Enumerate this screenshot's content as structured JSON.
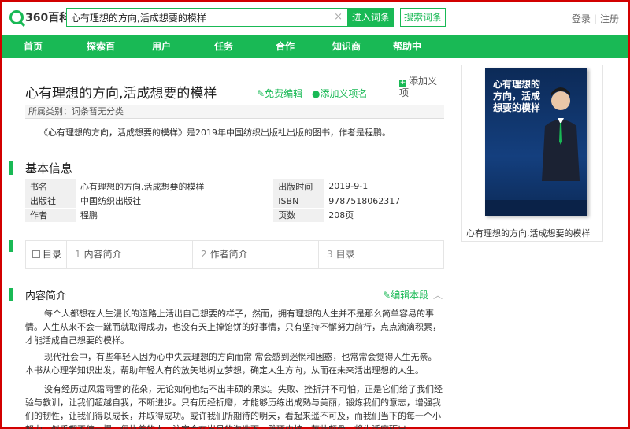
{
  "header": {
    "logo_text": "360百科",
    "search_value": "心有理想的方向,活成想要的模样",
    "enter_button": "进入词条",
    "search_button": "搜索词条",
    "login": "登录",
    "register": "注册"
  },
  "nav": {
    "items": [
      "首页",
      "探索百",
      "用户",
      "任务",
      "合作",
      "知识商",
      "帮助中"
    ]
  },
  "entry": {
    "title": "心有理想的方向,活成想要的模样",
    "edit_label": "免费编辑",
    "add_sense_label": "添加义项名",
    "add_item_label": "添加义项",
    "help_symbol": "?",
    "category": "所属类别：词条暂无分类",
    "summary": "《心有理想的方向，活成想要的模样》是2019年中国纺织出版社出版的图书，作者是程鹏。"
  },
  "basic_info": {
    "heading": "基本信息",
    "rows": [
      {
        "k1": "书名",
        "v1": "心有理想的方向,活成想要的模样",
        "k2": "出版时间",
        "v2": "2019-9-1"
      },
      {
        "k1": "出版社",
        "v1": "中国纺织出版社",
        "k2": "ISBN",
        "v2": "9787518062317"
      },
      {
        "k1": "作者",
        "v1": "程鹏",
        "k2": "页数",
        "v2": "208页"
      }
    ]
  },
  "catalog": {
    "label": "目录",
    "items": [
      {
        "num": "1",
        "label": "内容简介"
      },
      {
        "num": "2",
        "label": "作者简介"
      },
      {
        "num": "3",
        "label": "目录"
      }
    ]
  },
  "content_intro": {
    "heading": "内容简介",
    "edit_label": "编辑本段",
    "chevron": "︿",
    "paragraphs": [
      "每个人都想在人生漫长的道路上活出自己想要的样子，然而，拥有理想的人生并不是那么简单容易的事情。人生从来不会一蹴而就取得成功，也没有天上掉馅饼的好事情，只有坚持不懈努力前行，点点滴滴积累，才能活成自己想要的模样。",
      "现代社会中，有些年轻人因为心中失去理想的方向而常 常会感到迷惘和困惑，也常常会觉得人生无亲。本书从心理学知识出发，帮助年轻人有的放矢地树立梦想，确定人生方向，从而在未来活出理想的人生。",
      "没有经历过风霜雨雪的花朵，无论如何也结不出丰硕的果实。失败、挫折并不可怕，正是它们给了我们经验与教训，让我们超越自我，不断进步。只有历经折磨，才能够历练出成熟与美丽，锻炼我们的意志，增强我们的韧性，让我们得以成长，并取得成功。或许我们所期待的明天，看起来遥不可及，而我们当下的每一个小努力，似乎都不值一提。但执着的人，注定会在岁月的淘洗下，雕琢内核，茧壮颇骨，将生活磨砺出"
    ]
  },
  "sidebar": {
    "book_cover_title": "心有理想的方向，活成想要的模样",
    "caption": "心有理想的方向,活成想要的模样"
  },
  "colors": {
    "brand_green": "#19b955",
    "window_border": "#d20000"
  }
}
